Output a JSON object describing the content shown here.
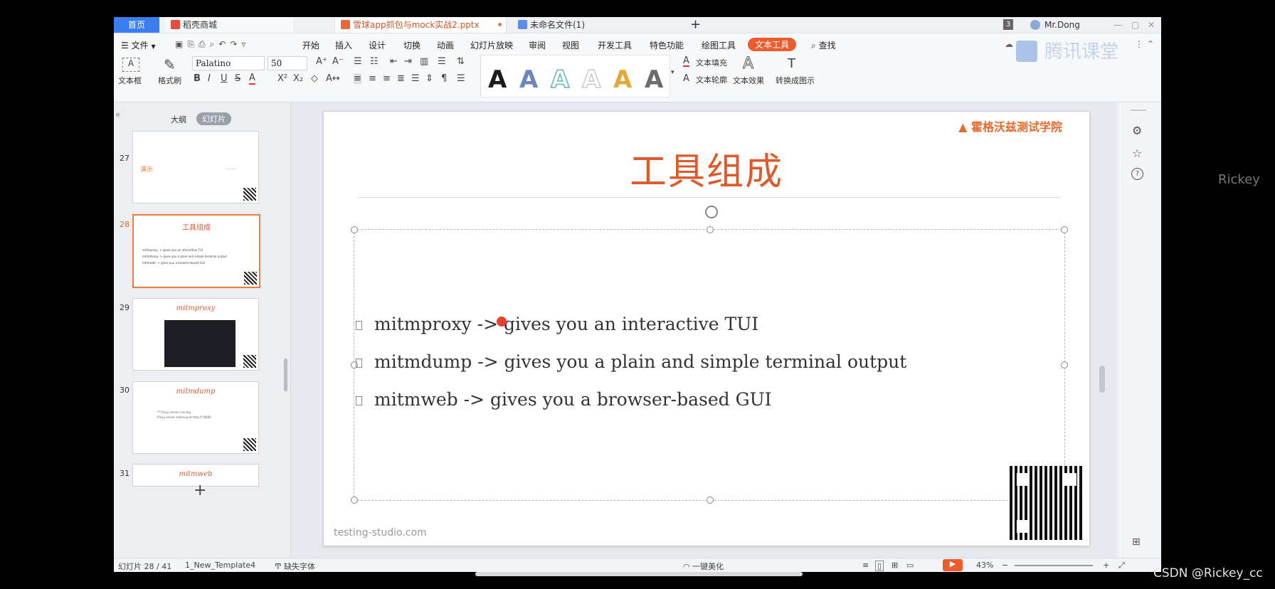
{
  "tabs": {
    "home": "首页",
    "mall": "稻壳商城",
    "file": "雪球app抓包与mock实战2.pptx",
    "untitled": "未命名文件(1)",
    "add": "+",
    "window_count": "3",
    "user": "Mr.Dong"
  },
  "menu": {
    "file": "文件",
    "items": [
      "开始",
      "插入",
      "设计",
      "切换",
      "动画",
      "幻灯片放映",
      "审阅",
      "视图",
      "开发工具",
      "特色功能",
      "绘图工具"
    ],
    "active": "文本工具",
    "search": "查找"
  },
  "ribbon": {
    "textbox": "文本框",
    "format_painter": "格式刷",
    "font": "Palatino",
    "size": "50",
    "styles": [
      "A",
      "A",
      "A",
      "A",
      "A",
      "A"
    ],
    "style_colors": [
      "#1b1b1b",
      "#6b86b8",
      "#5fb6b3",
      "#d8d8d8",
      "#e1a83c",
      "#6b6b6b"
    ],
    "fill": "文本填充",
    "outline": "文本轮廓",
    "effect": "文本效果",
    "convert": "转换成图示"
  },
  "panel": {
    "outline_tab": "大纲",
    "slides_tab": "幻灯片",
    "add": "+",
    "thumbs": [
      {
        "num": "27",
        "title": "演示",
        "sub": "……"
      },
      {
        "num": "28",
        "title": "工具组成",
        "lines": [
          "mitmproxy -> gives you an interactive TUI",
          "mitmdump -> gives you a plain and simple terminal output",
          "mitmweb -> gives you a browser-based GUI"
        ]
      },
      {
        "num": "29",
        "title": "mitmproxy"
      },
      {
        "num": "30",
        "title": "mitmdump",
        "lines": [
          "** Proxy server running",
          "Proxy server listening at http://*:8080"
        ]
      },
      {
        "num": "31",
        "title": "mitmweb"
      }
    ]
  },
  "slide": {
    "logo": "霍格沃兹测试学院",
    "title": "工具组成",
    "bullets": [
      "mitmproxy -> gives you an interactive TUI",
      "mitmdump -> gives you a plain and simple terminal output",
      "mitmweb -> gives you a browser-based GUI"
    ],
    "footer": "testing-studio.com"
  },
  "status": {
    "slide_info": "幻灯片 28 / 41",
    "template": "1_New_Template4",
    "missing_font": "缺失字体",
    "beautify": "一键美化",
    "zoom": "43%"
  },
  "overlay": {
    "watermark": "腾讯课堂",
    "side_name": "Rickey",
    "credit": "CSDN @Rickey_cc"
  }
}
